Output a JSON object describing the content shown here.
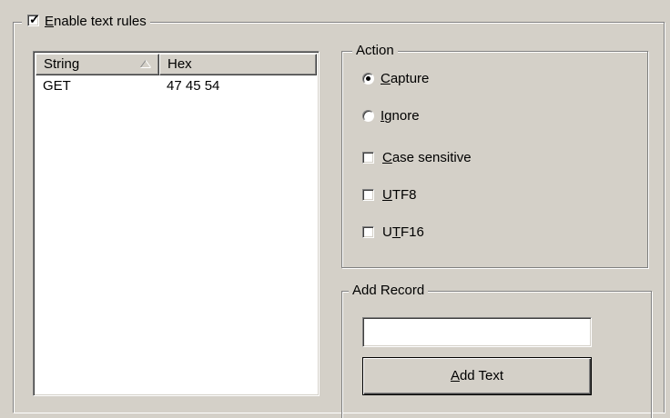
{
  "enable_rules": {
    "label_key": "E",
    "label_rest": "nable text rules",
    "checked": true
  },
  "list": {
    "columns": [
      {
        "label": "String",
        "sort": "ascending"
      },
      {
        "label": "Hex"
      }
    ],
    "rows": [
      {
        "string": "GET",
        "hex": "47 45 54"
      }
    ]
  },
  "action": {
    "title": "Action",
    "capture": {
      "key": "C",
      "rest": "apture",
      "selected": true
    },
    "ignore": {
      "key": "I",
      "rest": "gnore",
      "selected": false
    },
    "case_sensitive": {
      "key": "C",
      "rest": "ase sensitive",
      "checked": false
    },
    "utf8": {
      "key": "U",
      "rest": "TF8",
      "checked": false
    },
    "utf16": {
      "pre": "U",
      "key": "T",
      "rest": "F16",
      "checked": false
    }
  },
  "add_record": {
    "title": "Add Record",
    "input_value": "",
    "button": {
      "key": "A",
      "rest": "dd Text"
    }
  }
}
